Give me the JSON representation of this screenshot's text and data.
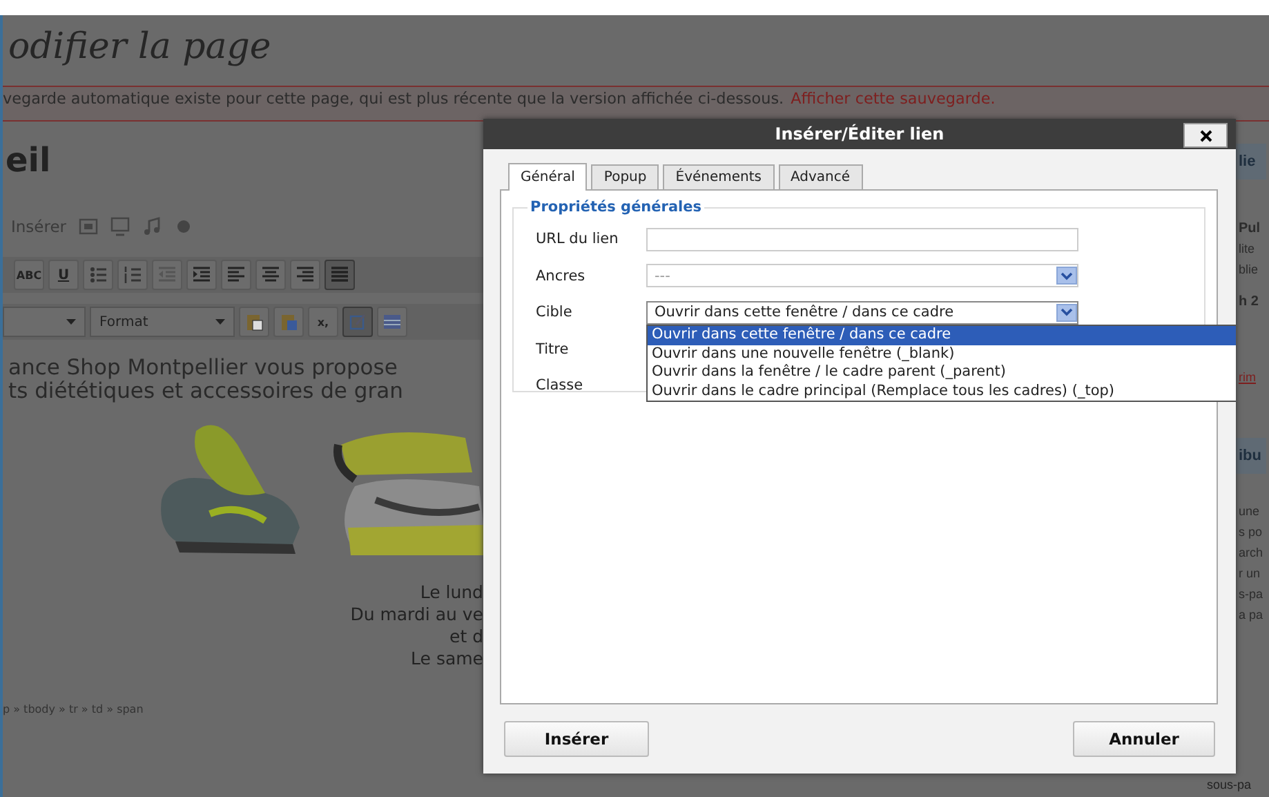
{
  "page": {
    "heading": "odifier la page",
    "notice": {
      "text": "vegarde automatique existe pour cette page, qui est plus récente que la version affichée ci-dessous.",
      "link": "Afficher cette sauvegarde."
    },
    "title": "eil",
    "media_label": "Insérer",
    "toolbar_row1": [
      {
        "kind": "text",
        "label": "ABC",
        "active": false
      },
      {
        "kind": "text",
        "label": "U",
        "active": false
      },
      {
        "kind": "bullets",
        "active": false
      },
      {
        "kind": "numbers",
        "active": false
      },
      {
        "kind": "outdent",
        "active": false
      },
      {
        "kind": "indent",
        "active": false
      },
      {
        "kind": "align-left",
        "active": false
      },
      {
        "kind": "align-center",
        "active": false
      },
      {
        "kind": "align-right",
        "active": false
      },
      {
        "kind": "justify",
        "active": true
      }
    ],
    "format_label": "Format",
    "toolbar_row2": [
      {
        "kind": "paste",
        "active": false
      },
      {
        "kind": "paste-word",
        "active": false
      },
      {
        "kind": "text",
        "label": "x,",
        "active": false
      },
      {
        "kind": "edit",
        "active": true
      },
      {
        "kind": "table",
        "active": false
      }
    ],
    "content_lines": [
      "ance Shop Montpellier vous propose",
      "ts diététiques et accessoires de gran"
    ],
    "hours_lines": [
      "Le lund",
      "Du mardi au ve",
      "et d",
      "Le same"
    ],
    "path": "p » tbody » tr » td » span",
    "sidebar": [
      {
        "kind": "header",
        "text": "lie"
      },
      {
        "kind": "bold",
        "text": "Pul"
      },
      {
        "kind": "text",
        "text": "lite"
      },
      {
        "kind": "text",
        "text": "blie"
      },
      {
        "kind": "bold",
        "text": "h 2"
      },
      {
        "kind": "link",
        "text": "rim"
      },
      {
        "kind": "header",
        "text": "ibu"
      },
      {
        "kind": "text",
        "text": "une"
      },
      {
        "kind": "text",
        "text": "s po"
      },
      {
        "kind": "text",
        "text": "arch"
      },
      {
        "kind": "text",
        "text": "r un"
      },
      {
        "kind": "text",
        "text": "s-pa"
      },
      {
        "kind": "text",
        "text": "a pa"
      },
      {
        "kind": "text",
        "text": "sous-pa"
      }
    ]
  },
  "dialog": {
    "title": "Insérer/Éditer lien",
    "tabs": [
      {
        "label": "Général",
        "selected": true
      },
      {
        "label": "Popup",
        "selected": false
      },
      {
        "label": "Événements",
        "selected": false
      },
      {
        "label": "Advancé",
        "selected": false
      }
    ],
    "legend": "Propriétés générales",
    "fields": [
      {
        "kind": "text",
        "label": "URL du lien"
      },
      {
        "kind": "select",
        "label": "Ancres",
        "value": "---",
        "open": false
      },
      {
        "kind": "select",
        "label": "Cible",
        "value": "Ouvrir dans cette fenêtre / dans ce cadre",
        "open": true,
        "options": [
          {
            "text": "Ouvrir dans cette fenêtre / dans ce cadre",
            "selected": true
          },
          {
            "text": "Ouvrir dans une nouvelle fenêtre (_blank)",
            "selected": false
          },
          {
            "text": "Ouvrir dans la fenêtre / le cadre parent (_parent)",
            "selected": false
          },
          {
            "text": "Ouvrir dans le cadre principal (Remplace tous les cadres) (_top)",
            "selected": false
          }
        ]
      },
      {
        "kind": "covered",
        "label": "Titre"
      },
      {
        "kind": "covered",
        "label": "Classe"
      }
    ],
    "buttons": [
      "Insérer",
      "Annuler"
    ]
  }
}
